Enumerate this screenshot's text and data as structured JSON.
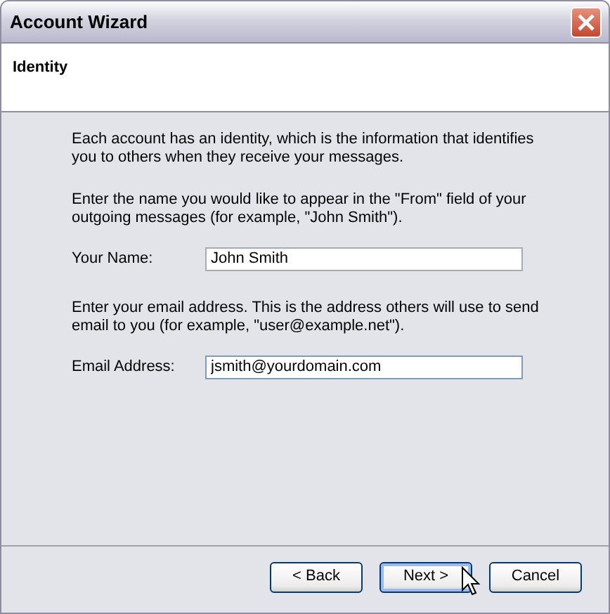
{
  "window": {
    "title": "Account Wizard"
  },
  "page": {
    "title": "Identity"
  },
  "intro": "Each account has an identity, which is the information that identifies you to others when they receive your messages.",
  "fields": [
    {
      "description": "Enter the name you would like to appear in the \"From\" field of your outgoing messages (for example, \"John Smith\").",
      "label": "Your Name:",
      "value": "John Smith",
      "focused": false
    },
    {
      "description": "Enter your email address. This is the address others will use to send email to you (for example, \"user@example.net\").",
      "label": "Email Address:",
      "value": "jsmith@yourdomain.com",
      "focused": true
    }
  ],
  "buttons": [
    {
      "label": "< Back",
      "hovered": false
    },
    {
      "label": "Next >",
      "hovered": true
    },
    {
      "label": "Cancel",
      "hovered": false
    }
  ]
}
